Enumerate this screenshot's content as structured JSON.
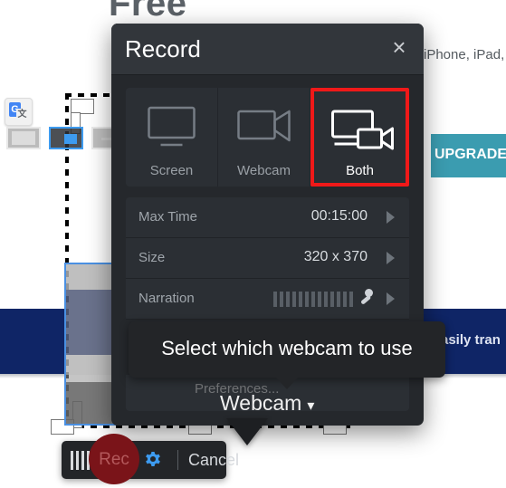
{
  "background": {
    "heading": "Free",
    "top_text": "iPhone, iPad,",
    "upgrade_label": "UPGRADE Rec",
    "banner_text": "asily tran",
    "translate_icon": {
      "g": "G",
      "a": "文"
    }
  },
  "dialog": {
    "title": "Record",
    "close_icon": "×",
    "modes": [
      {
        "id": "screen",
        "label": "Screen",
        "icon": "monitor-icon",
        "active": false
      },
      {
        "id": "webcam",
        "label": "Webcam",
        "icon": "camcorder-icon",
        "active": false
      },
      {
        "id": "both",
        "label": "Both",
        "icon": "monitor-and-camcorder-icon",
        "active": true
      }
    ],
    "settings": [
      {
        "id": "max-time",
        "name": "Max Time",
        "value": "00:15:00"
      },
      {
        "id": "size",
        "name": "Size",
        "value": "320 x 370"
      },
      {
        "id": "narration",
        "name": "Narration",
        "value": ""
      }
    ],
    "preferences_label": "Preferences..."
  },
  "tooltip": {
    "text": "Select which webcam to use"
  },
  "webcam_dropdown": {
    "label": "Webcam",
    "caret": "▾"
  },
  "window_state_buttons": [
    {
      "id": "maximize",
      "name": "maximize-window-button",
      "selected": false
    },
    {
      "id": "restore",
      "name": "restore-window-button",
      "selected": true
    },
    {
      "id": "minimize",
      "name": "minimize-window-button",
      "selected": false
    }
  ],
  "recbar": {
    "rec_label": "Rec",
    "cancel_label": "Cancel",
    "gear_icon": "gear-icon"
  },
  "colors": {
    "dialog_bg": "#25282c",
    "dialog_titlebar": "#32363b",
    "row_bg": "#2b2f34",
    "highlight_red": "#f01919",
    "accent_blue": "#4a90e2",
    "banner_blue": "#0f2566",
    "upgrade_teal": "#3b9cb0",
    "rec_red": "#7a1419"
  }
}
